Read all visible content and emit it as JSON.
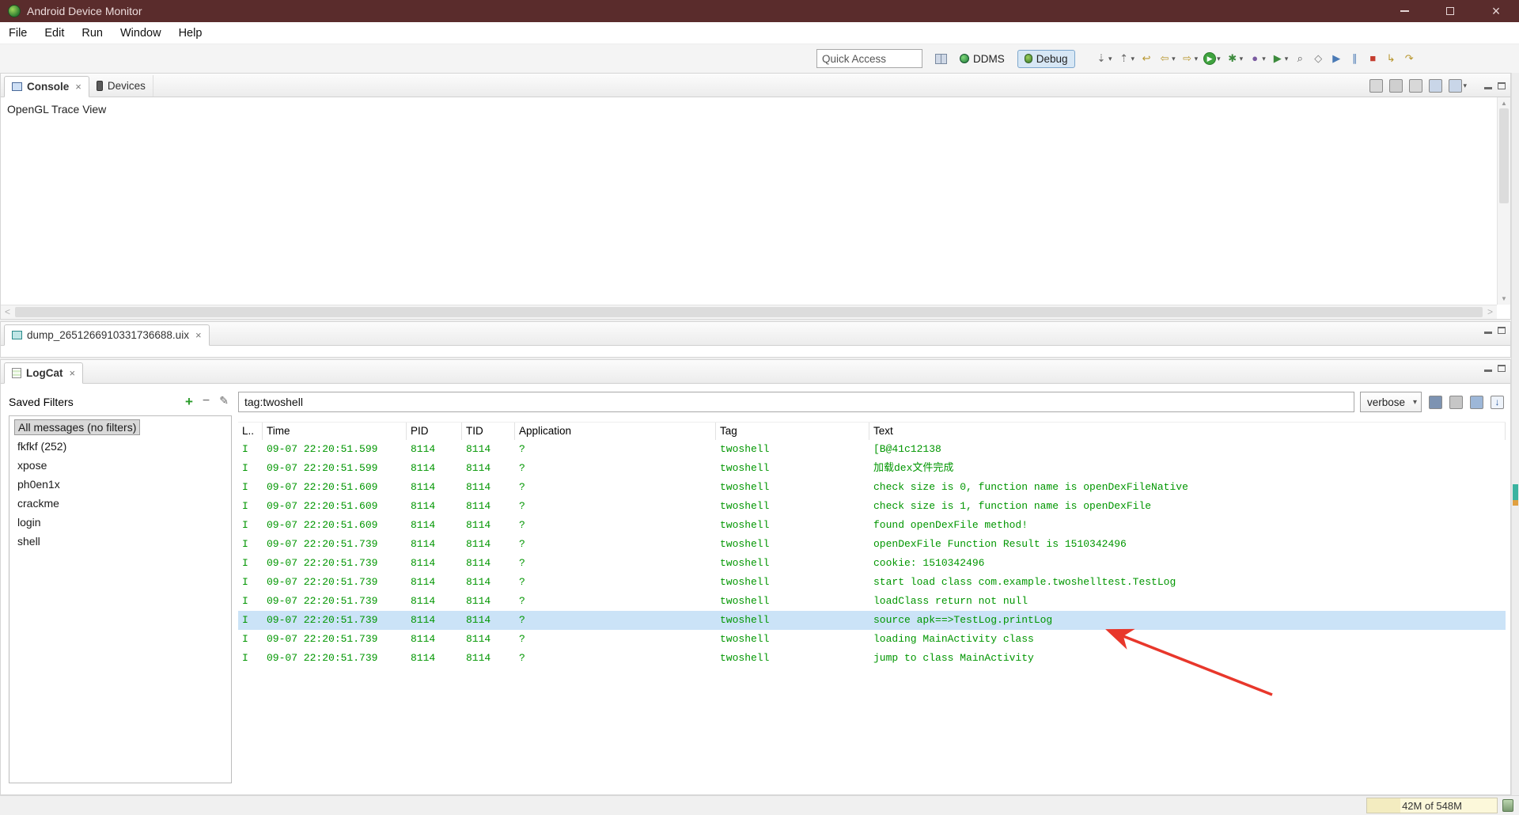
{
  "window": {
    "title": "Android Device Monitor"
  },
  "glyphs": {
    "close": "×",
    "tab_close": "×",
    "dropdown": "▾",
    "scroll_up": "▲",
    "scroll_down": "▼",
    "scroll_left": "<",
    "scroll_right": ">",
    "add_filter": "+",
    "delete_filter": "−",
    "edit_filter": "✎",
    "level_chevron": "▾"
  },
  "menu": {
    "items": [
      "File",
      "Edit",
      "Run",
      "Window",
      "Help"
    ]
  },
  "toolbar": {
    "quick_access_value": "Quick Access",
    "ddms_label": "DDMS",
    "debug_label": "Debug",
    "icons": [
      {
        "name": "next-annotation-icon",
        "glyph": "⇣",
        "color": "#6a6a6a",
        "dropdown": true
      },
      {
        "name": "previous-annotation-icon",
        "glyph": "⇡",
        "color": "#6a6a6a",
        "dropdown": true
      },
      {
        "name": "last-edit-location-icon",
        "glyph": "↩",
        "color": "#b8962e"
      },
      {
        "name": "back-icon",
        "glyph": "⇦",
        "color": "#b8962e",
        "dropdown": true
      },
      {
        "name": "forward-icon",
        "glyph": "⇨",
        "color": "#b8962e",
        "dropdown": true
      },
      {
        "name": "run-icon",
        "glyph": "▶",
        "color": "#ffffff",
        "circle": true,
        "dropdown": true
      },
      {
        "name": "debug-launch-icon",
        "glyph": "✱",
        "color": "#3c8a3c",
        "dropdown": true
      },
      {
        "name": "coverage-icon",
        "glyph": "●",
        "color": "#7a5aa0",
        "dropdown": true
      },
      {
        "name": "external-tools-icon",
        "glyph": "▶",
        "color": "#3c8a3c",
        "dropdown": true
      },
      {
        "name": "search-icon",
        "glyph": "⌕",
        "color": "#555555"
      },
      {
        "name": "open-type-icon",
        "glyph": "◇",
        "color": "#777777"
      },
      {
        "name": "resume-icon",
        "glyph": "▶",
        "color": "#4a7ab5"
      },
      {
        "name": "suspend-icon",
        "glyph": "∥",
        "color": "#4a7ab5"
      },
      {
        "name": "terminate-icon",
        "glyph": "■",
        "color": "#c43c2e"
      },
      {
        "name": "step-into-icon",
        "glyph": "↳",
        "color": "#b8962e"
      },
      {
        "name": "step-over-icon",
        "glyph": "↷",
        "color": "#b8962e"
      }
    ]
  },
  "console_panel": {
    "tabs": [
      {
        "label": "Console"
      },
      {
        "label": "Devices"
      }
    ],
    "view_title": "OpenGL Trace View",
    "corner_icons": [
      {
        "name": "clear-console-icon",
        "bg": "#d8d8d8"
      },
      {
        "name": "scroll-lock-icon",
        "bg": "#cfcfcf"
      },
      {
        "name": "pin-console-icon",
        "bg": "#d8d8d8"
      },
      {
        "name": "display-selected-console-icon",
        "bg": "#c9d6e8"
      },
      {
        "name": "open-console-icon",
        "bg": "#c9d6e8",
        "dropdown": true
      }
    ]
  },
  "editor_panel": {
    "tab_label": "dump_2651266910331736688.uix"
  },
  "logcat": {
    "tab_label": "LogCat",
    "saved_filters": {
      "title": "Saved Filters",
      "items": [
        "All messages (no filters)",
        "fkfkf (252)",
        "xpose",
        "ph0en1x",
        "crackme",
        "login",
        "shell"
      ],
      "selected_index": 0
    },
    "search_value": "tag:twoshell",
    "level_filter": "verbose",
    "toolbar_icons": [
      {
        "name": "save-log-icon",
        "bg": "#7d93b2"
      },
      {
        "name": "clear-log-icon",
        "bg": "#c6c6c6"
      },
      {
        "name": "display-saved-filters-view-icon",
        "bg": "#9db7d8"
      },
      {
        "name": "scroll-to-latest-icon",
        "glyph": "↓",
        "color": "#2a5aa0",
        "bg": "#eef3fa"
      }
    ],
    "table": {
      "columns": [
        "L..",
        "Time",
        "PID",
        "TID",
        "Application",
        "Tag",
        "Text"
      ],
      "selected_row_index": 9,
      "rows": [
        {
          "level": "I",
          "time": "09-07 22:20:51.599",
          "pid": "8114",
          "tid": "8114",
          "application": "?",
          "tag": "twoshell",
          "text": "[B@41c12138"
        },
        {
          "level": "I",
          "time": "09-07 22:20:51.599",
          "pid": "8114",
          "tid": "8114",
          "application": "?",
          "tag": "twoshell",
          "text": "加载dex文件完成"
        },
        {
          "level": "I",
          "time": "09-07 22:20:51.609",
          "pid": "8114",
          "tid": "8114",
          "application": "?",
          "tag": "twoshell",
          "text": "check size is 0, function name is openDexFileNative"
        },
        {
          "level": "I",
          "time": "09-07 22:20:51.609",
          "pid": "8114",
          "tid": "8114",
          "application": "?",
          "tag": "twoshell",
          "text": "check size is 1, function name is openDexFile"
        },
        {
          "level": "I",
          "time": "09-07 22:20:51.609",
          "pid": "8114",
          "tid": "8114",
          "application": "?",
          "tag": "twoshell",
          "text": "found openDexFile method!"
        },
        {
          "level": "I",
          "time": "09-07 22:20:51.739",
          "pid": "8114",
          "tid": "8114",
          "application": "?",
          "tag": "twoshell",
          "text": "openDexFile Function Result is 1510342496"
        },
        {
          "level": "I",
          "time": "09-07 22:20:51.739",
          "pid": "8114",
          "tid": "8114",
          "application": "?",
          "tag": "twoshell",
          "text": "cookie: 1510342496"
        },
        {
          "level": "I",
          "time": "09-07 22:20:51.739",
          "pid": "8114",
          "tid": "8114",
          "application": "?",
          "tag": "twoshell",
          "text": "start load class com.example.twoshelltest.TestLog"
        },
        {
          "level": "I",
          "time": "09-07 22:20:51.739",
          "pid": "8114",
          "tid": "8114",
          "application": "?",
          "tag": "twoshell",
          "text": "loadClass return not null"
        },
        {
          "level": "I",
          "time": "09-07 22:20:51.739",
          "pid": "8114",
          "tid": "8114",
          "application": "?",
          "tag": "twoshell",
          "text": "source apk==>TestLog.printLog"
        },
        {
          "level": "I",
          "time": "09-07 22:20:51.739",
          "pid": "8114",
          "tid": "8114",
          "application": "?",
          "tag": "twoshell",
          "text": "loading MainActivity class"
        },
        {
          "level": "I",
          "time": "09-07 22:20:51.739",
          "pid": "8114",
          "tid": "8114",
          "application": "?",
          "tag": "twoshell",
          "text": "jump to class MainActivity"
        }
      ]
    }
  },
  "status_bar": {
    "memory_usage": "42M of 548M"
  },
  "colors": {
    "titlebar": "#5a2c2c",
    "log_text": "#009600",
    "selected_row_bg": "#cbe3f7",
    "debug_active_bg": "#d7e7f5",
    "annotation_arrow": "#e8372b"
  }
}
